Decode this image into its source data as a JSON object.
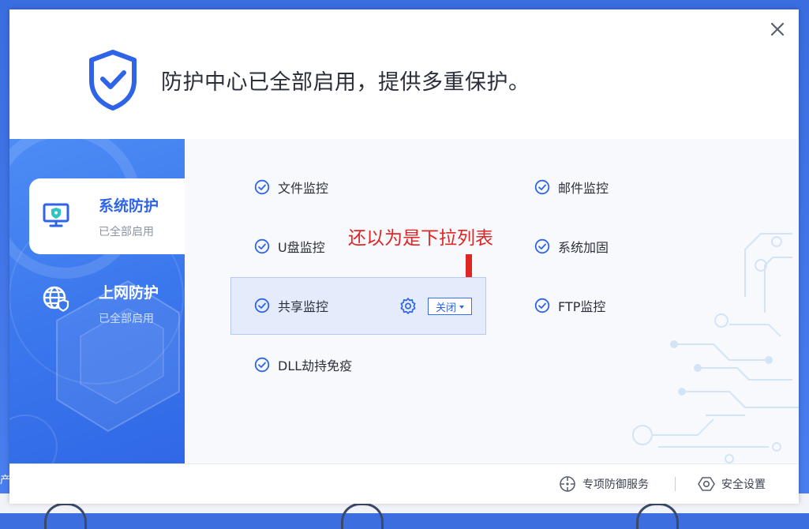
{
  "header": {
    "title": "防护中心已全部启用，提供多重保护。"
  },
  "sidebar": {
    "items": [
      {
        "title": "系统防护",
        "subtitle": "已全部启用",
        "icon": "monitor-shield-icon",
        "active": true
      },
      {
        "title": "上网防护",
        "subtitle": "已全部启用",
        "icon": "globe-shield-icon",
        "active": false
      }
    ]
  },
  "features": {
    "file_monitor": "文件监控",
    "mail_monitor": "邮件监控",
    "usb_monitor": "U盘监控",
    "system_harden": "系统加固",
    "share_monitor": "共享监控",
    "ftp_monitor": "FTP监控",
    "dll_hijack": "DLL劫持免疫"
  },
  "share_dropdown": {
    "value": "关闭"
  },
  "annotation": {
    "text": "还以为是下拉列表",
    "color": "#e02525"
  },
  "footer": {
    "special_service": "专项防御服务",
    "security_settings": "安全设置"
  },
  "background": {
    "left_char": "产"
  },
  "colors": {
    "accent": "#2f64e8",
    "sidebar": "#3a76ec",
    "annotation": "#e02525"
  }
}
